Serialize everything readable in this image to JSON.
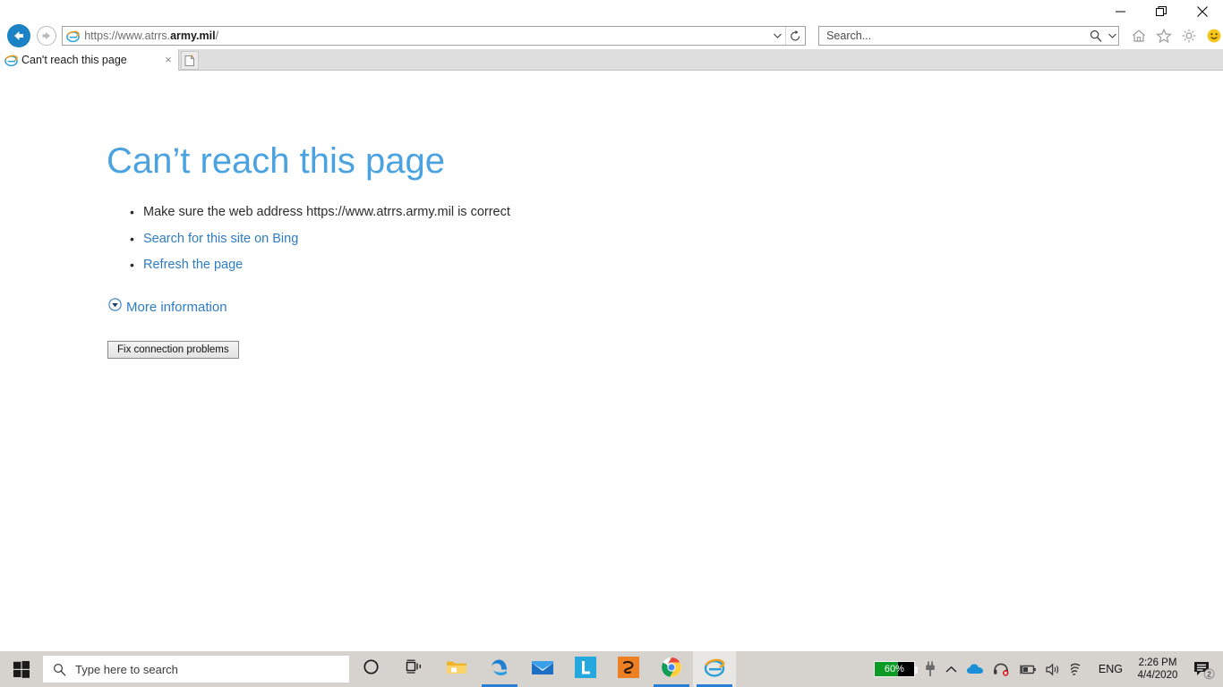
{
  "window": {
    "controls": {
      "minimize": "minimize-button",
      "restore": "restore-button",
      "close": "close-button"
    }
  },
  "navigation": {
    "back": "Back",
    "forward": "Forward",
    "address": {
      "url_prefix": "https://www.atrrs.",
      "url_bold": "army.mil",
      "url_suffix": "/",
      "full_url": "https://www.atrrs.army.mil/"
    },
    "refresh": "Refresh",
    "dropdown": "Address dropdown"
  },
  "search": {
    "placeholder": "Search...",
    "value": "Search..."
  },
  "toolbar": {
    "home": "home-icon",
    "favorites": "favorites-star-icon",
    "tools": "tools-gear-icon",
    "feedback": "smiley-feedback-icon"
  },
  "tabs": [
    {
      "title": "Can't reach this page",
      "close": "×",
      "active": true
    }
  ],
  "newtab": {
    "label": "New tab"
  },
  "page": {
    "title": "Can’t reach this page",
    "bullets": [
      {
        "text": "Make sure the web address https://www.atrrs.army.mil is correct",
        "link": false
      },
      {
        "text": "Search for this site on Bing",
        "link": true
      },
      {
        "text": "Refresh the page",
        "link": true
      }
    ],
    "more_information": "More information",
    "fix_button": "Fix connection problems"
  },
  "taskbar": {
    "start": "windows-start-icon",
    "search_placeholder": "Type here to search",
    "cortana": "cortana-circle-icon",
    "taskview": "task-view-icon",
    "apps": [
      {
        "name": "file-explorer",
        "running": false
      },
      {
        "name": "microsoft-edge",
        "running": true
      },
      {
        "name": "mail",
        "running": false
      },
      {
        "name": "lastpass",
        "running": false
      },
      {
        "name": "orange-app",
        "running": false
      },
      {
        "name": "google-chrome",
        "running": true
      },
      {
        "name": "internet-explorer",
        "running": true,
        "active": true
      }
    ],
    "tray": {
      "battery_percent": "60%",
      "battery_value": 60,
      "plug": "power-plug-icon",
      "chevron": "show-hidden-icons-icon",
      "onedrive": "onedrive-cloud-icon",
      "headset": "headset-disconnected-icon",
      "battery_status": "battery-charging-icon",
      "volume": "speaker-icon",
      "network": "wifi-icon",
      "language": "ENG",
      "time": "2:26 PM",
      "date": "4/4/2020",
      "notifications_count": "2"
    }
  },
  "colors": {
    "accent_blue": "#2d7dc4",
    "title_blue": "#4aa3e0",
    "taskbar": "#d6d3ce",
    "battery_green": "#0c9b25",
    "ie_blue": "#1b82c4"
  }
}
